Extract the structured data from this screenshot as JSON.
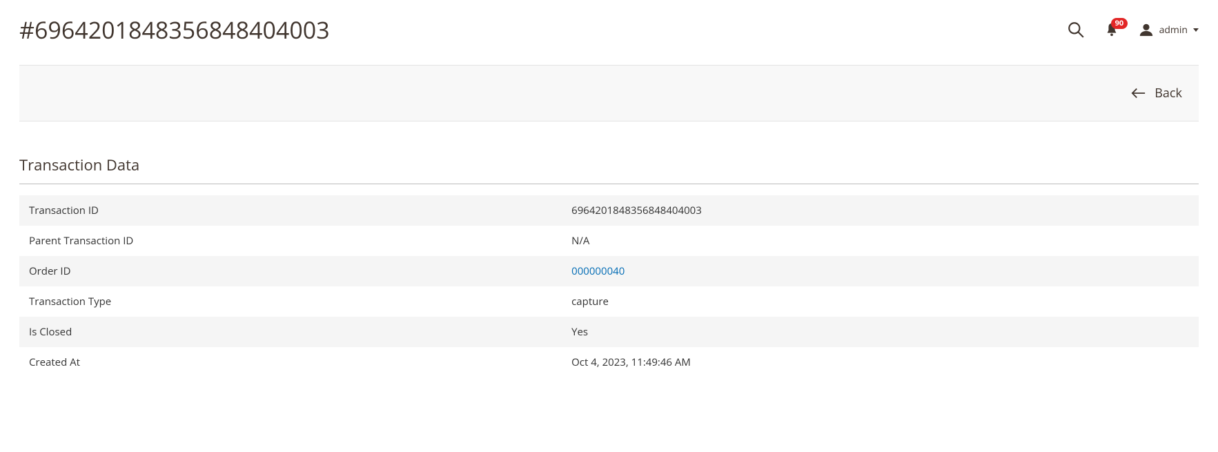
{
  "header": {
    "title": "#6964201848356848404003",
    "notification_count": "90",
    "user_name": "admin"
  },
  "toolbar": {
    "back_label": "Back"
  },
  "section": {
    "title": "Transaction Data",
    "rows": [
      {
        "label": "Transaction ID",
        "value": "6964201848356848404003",
        "is_link": false
      },
      {
        "label": "Parent Transaction ID",
        "value": "N/A",
        "is_link": false
      },
      {
        "label": "Order ID",
        "value": "000000040",
        "is_link": true
      },
      {
        "label": "Transaction Type",
        "value": "capture",
        "is_link": false
      },
      {
        "label": "Is Closed",
        "value": "Yes",
        "is_link": false
      },
      {
        "label": "Created At",
        "value": "Oct 4, 2023, 11:49:46 AM",
        "is_link": false
      }
    ]
  }
}
